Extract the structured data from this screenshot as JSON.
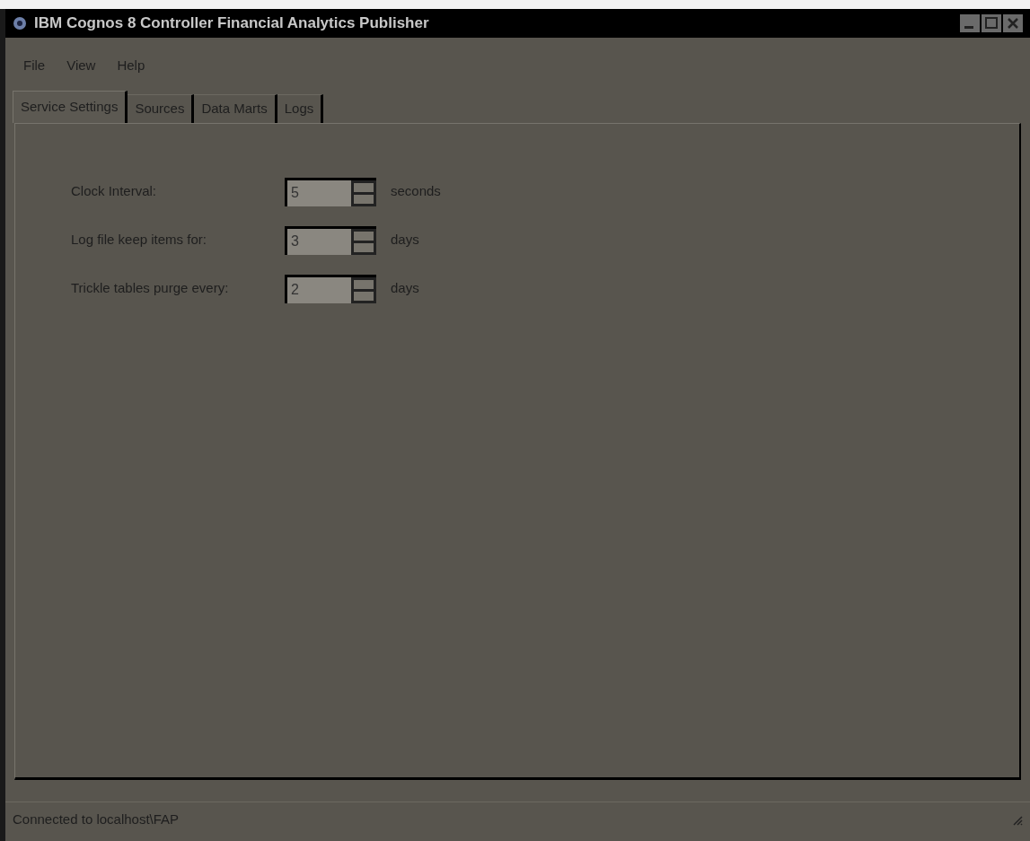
{
  "window": {
    "title": "IBM Cognos 8 Controller Financial Analytics Publisher"
  },
  "menu": [
    "File",
    "View",
    "Help"
  ],
  "tabs": [
    {
      "label": "Service Settings",
      "selected": true
    },
    {
      "label": "Sources",
      "selected": false
    },
    {
      "label": "Data Marts",
      "selected": false
    },
    {
      "label": "Logs",
      "selected": false
    }
  ],
  "settings": [
    {
      "label": "Clock Interval:",
      "value": "5",
      "unit": "seconds"
    },
    {
      "label": "Log file keep items for:",
      "value": "3",
      "unit": "days"
    },
    {
      "label": "Trickle tables purge every:",
      "value": "2",
      "unit": "days"
    }
  ],
  "status_bar": "Connected to localhost\\FAP"
}
